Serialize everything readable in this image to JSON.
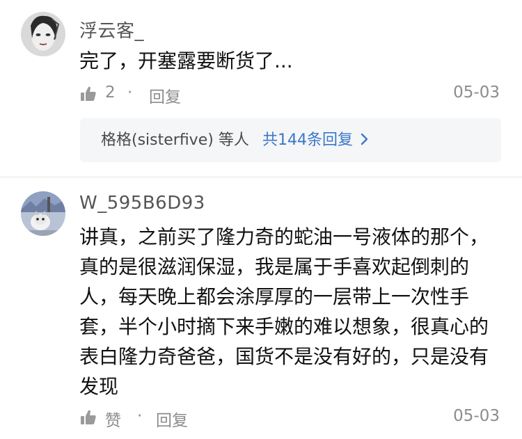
{
  "comments": [
    {
      "username": "浮云客_",
      "text": "完了，开塞露要断货了...",
      "like_label": "2",
      "dot": "·",
      "reply_label": "回复",
      "date": "05-03",
      "replies_summary": {
        "who": "格格(sisterfive) 等人",
        "more": "共144条回复"
      }
    },
    {
      "username": "W_595B6D93",
      "text": "讲真，之前买了隆力奇的蛇油一号液体的那个，\n真的是很滋润保湿，我是属于手喜欢起倒刺的\n人，每天晚上都会涂厚厚的一层带上一次性手\n套，半个小时摘下来手嫩的难以想象，很真心的\n表白隆力奇爸爸，国货不是没有好的，只是没有\n发现",
      "like_label": "赞",
      "dot": "·",
      "reply_label": "回复",
      "date": "05-03"
    }
  ],
  "icons": {
    "like": "thumbs-up-icon",
    "chevron": "chevron-right-icon"
  },
  "colors": {
    "link": "#3a78c6",
    "meta": "#8c8c8c",
    "reply_box_bg": "#f5f6f8"
  }
}
